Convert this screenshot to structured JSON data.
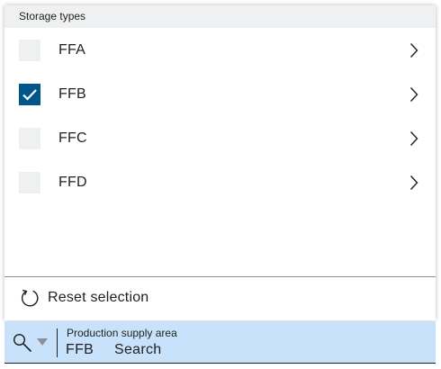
{
  "panel": {
    "header": "Storage types",
    "items": [
      {
        "label": "FFA",
        "checked": false
      },
      {
        "label": "FFB",
        "checked": true
      },
      {
        "label": "FFC",
        "checked": false
      },
      {
        "label": "FFD",
        "checked": false
      }
    ],
    "reset_label": "Reset selection"
  },
  "search_field": {
    "label": "Production supply area",
    "value": "FFB",
    "placeholder": "Search"
  },
  "icons": {
    "check": "check-icon",
    "chevron": "chevron-right-icon",
    "reset": "refresh-icon",
    "search": "search-icon",
    "dropdown": "caret-down-icon"
  },
  "colors": {
    "accent": "#00568a",
    "checkbox_bg": "#eff0f1",
    "header_bg": "#eff0f1",
    "field_bg": "#c9e2fb"
  }
}
